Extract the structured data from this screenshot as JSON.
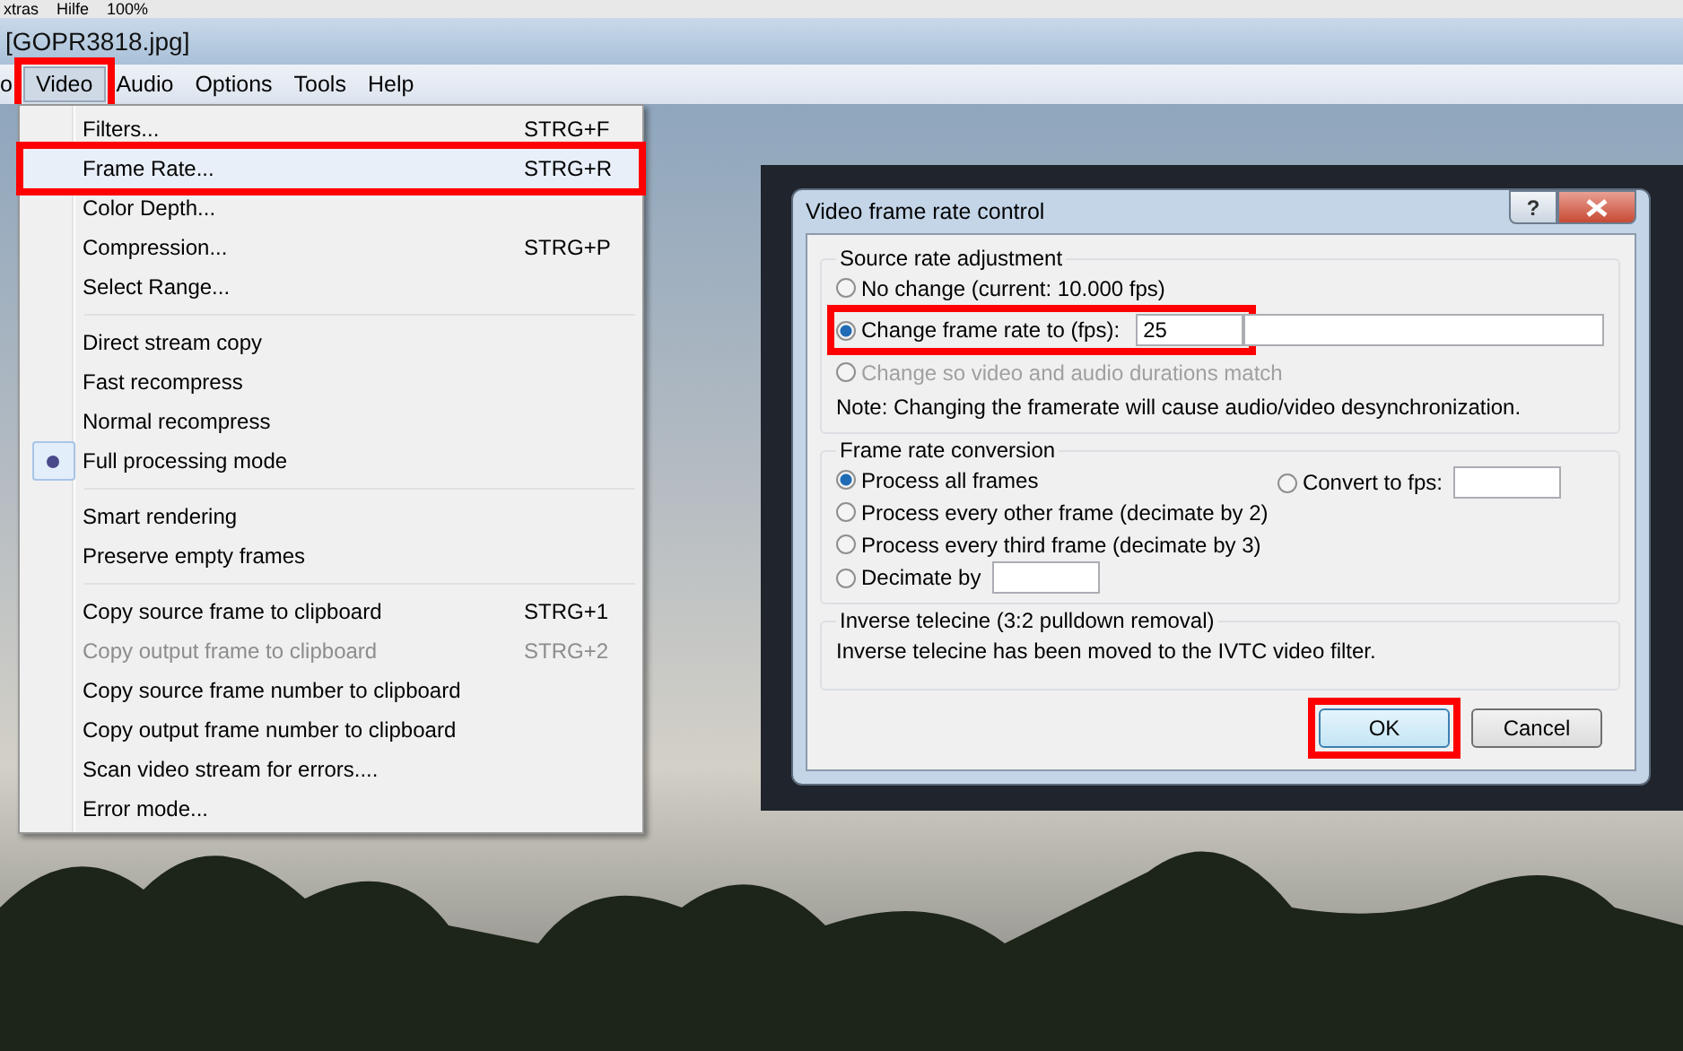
{
  "top_strip": [
    "xtras",
    "Hilfe",
    "100%"
  ],
  "window": {
    "title": "[GOPR3818.jpg]"
  },
  "menu_bar": [
    {
      "label": "o",
      "selected": false,
      "highlighted": false
    },
    {
      "label": "Video",
      "selected": true,
      "highlighted": true
    },
    {
      "label": "Audio",
      "selected": false,
      "highlighted": false
    },
    {
      "label": "Options",
      "selected": false,
      "highlighted": false
    },
    {
      "label": "Tools",
      "selected": false,
      "highlighted": false
    },
    {
      "label": "Help",
      "selected": false,
      "highlighted": false
    }
  ],
  "video_menu": [
    [
      {
        "label": "Filters...",
        "shortcut": "STRG+F",
        "disabled": false,
        "checked": false,
        "highlighted": false
      },
      {
        "label": "Frame Rate...",
        "shortcut": "STRG+R",
        "disabled": false,
        "checked": false,
        "highlighted": true
      },
      {
        "label": "Color Depth...",
        "disabled": false,
        "checked": false,
        "highlighted": false
      },
      {
        "label": "Compression...",
        "shortcut": "STRG+P",
        "disabled": false,
        "checked": false,
        "highlighted": false
      },
      {
        "label": "Select Range...",
        "disabled": false,
        "checked": false,
        "highlighted": false
      }
    ],
    [
      {
        "label": "Direct stream copy",
        "disabled": false,
        "checked": false,
        "highlighted": false
      },
      {
        "label": "Fast recompress",
        "disabled": false,
        "checked": false,
        "highlighted": false
      },
      {
        "label": "Normal recompress",
        "disabled": false,
        "checked": false,
        "highlighted": false
      },
      {
        "label": "Full processing mode",
        "disabled": false,
        "checked": true,
        "highlighted": false
      }
    ],
    [
      {
        "label": "Smart rendering",
        "disabled": false,
        "checked": false,
        "highlighted": false
      },
      {
        "label": "Preserve empty frames",
        "disabled": false,
        "checked": false,
        "highlighted": false
      }
    ],
    [
      {
        "label": "Copy source frame to clipboard",
        "shortcut": "STRG+1",
        "disabled": false,
        "checked": false,
        "highlighted": false
      },
      {
        "label": "Copy output frame to clipboard",
        "shortcut": "STRG+2",
        "disabled": true,
        "checked": false,
        "highlighted": false
      },
      {
        "label": "Copy source frame number to clipboard",
        "disabled": false,
        "checked": false,
        "highlighted": false
      },
      {
        "label": "Copy output frame number to clipboard",
        "disabled": false,
        "checked": false,
        "highlighted": false
      },
      {
        "label": "Scan video stream for errors....",
        "disabled": false,
        "checked": false,
        "highlighted": false
      },
      {
        "label": "Error mode...",
        "disabled": false,
        "checked": false,
        "highlighted": false
      }
    ]
  ],
  "dialog": {
    "title": "Video frame rate control",
    "help_button": "?",
    "source_rate": {
      "title": "Source rate adjustment",
      "options": [
        {
          "label": "No change (current: 10.000 fps)",
          "selected": false,
          "disabled": false,
          "highlighted": false
        },
        {
          "label": "Change frame rate to (fps):",
          "selected": true,
          "disabled": false,
          "highlighted": true,
          "value": "25"
        },
        {
          "label": "Change so video and audio durations match",
          "selected": false,
          "disabled": true,
          "highlighted": false
        }
      ],
      "note": "Note: Changing the framerate will cause audio/video desynchronization."
    },
    "conversion": {
      "title": "Frame rate conversion",
      "options": [
        {
          "kind": "radio",
          "label": "Process all frames",
          "selected": true
        },
        {
          "kind": "radio",
          "label": "Process every other frame (decimate by 2)",
          "selected": false
        },
        {
          "kind": "radio",
          "label": "Process every third frame (decimate by 3)",
          "selected": false
        },
        {
          "kind": "radio_with_field",
          "label": "Decimate by",
          "selected": false
        }
      ],
      "convert_option": {
        "label": "Convert to fps:",
        "selected": false
      }
    },
    "ivtc": {
      "title": "Inverse telecine (3:2 pulldown removal)",
      "text": "Inverse telecine has been moved to the IVTC video filter."
    },
    "buttons": [
      {
        "label": "OK",
        "default": true,
        "highlighted": true
      },
      {
        "label": "Cancel",
        "default": false,
        "highlighted": false
      }
    ]
  }
}
